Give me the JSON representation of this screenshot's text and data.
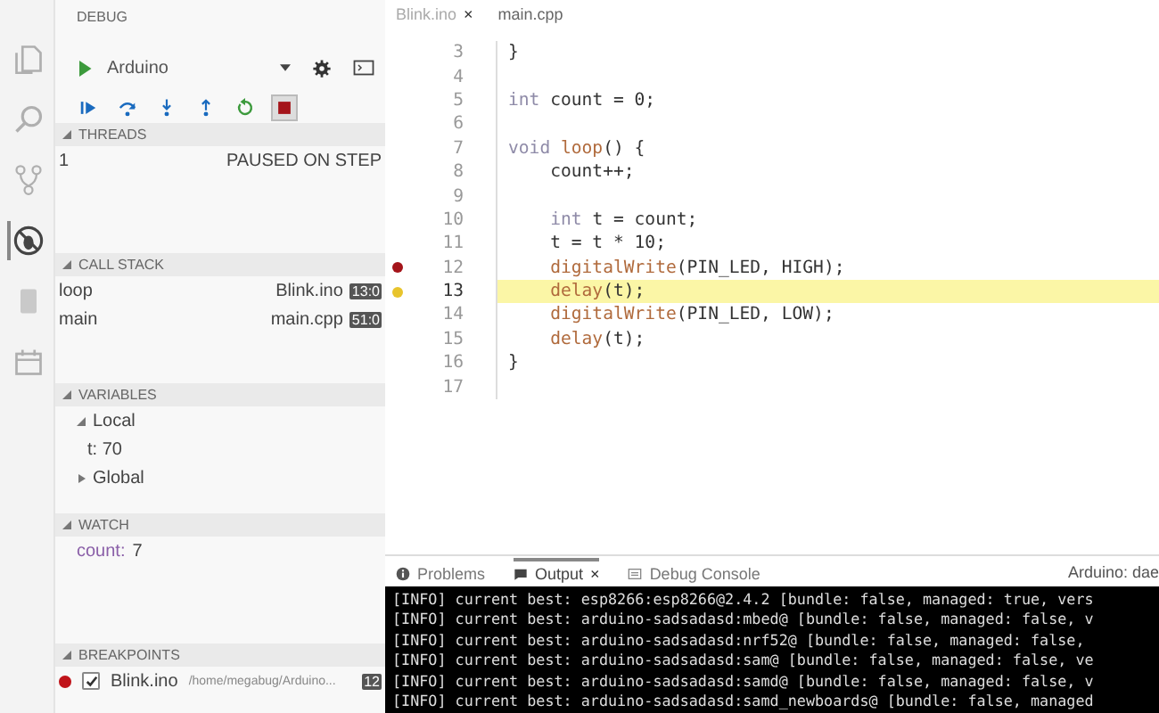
{
  "activity_bar": [
    {
      "kind": "files",
      "selected": false
    },
    {
      "kind": "search",
      "selected": false
    },
    {
      "kind": "source-control",
      "selected": false
    },
    {
      "kind": "debug",
      "selected": true
    },
    {
      "kind": "board",
      "selected": false
    },
    {
      "kind": "calendar",
      "selected": false
    }
  ],
  "sidebar": {
    "title": "DEBUG",
    "configuration": "Arduino",
    "toolbar": [
      {
        "kind": "continue",
        "hovered": false
      },
      {
        "kind": "step-over",
        "hovered": false
      },
      {
        "kind": "step-into",
        "hovered": false
      },
      {
        "kind": "step-out",
        "hovered": false
      },
      {
        "kind": "restart",
        "hovered": false
      },
      {
        "kind": "stop",
        "hovered": true
      }
    ],
    "sections": [
      {
        "kind": "threads",
        "title": "THREADS",
        "expanded": true,
        "rows": [
          {
            "id": "1",
            "status": "PAUSED ON STEP"
          }
        ]
      },
      {
        "kind": "call_stack",
        "title": "CALL STACK",
        "expanded": true,
        "frames": [
          {
            "name": "loop",
            "file": "Blink.ino",
            "position": "13:0"
          },
          {
            "name": "main",
            "file": "main.cpp",
            "position": "51:0"
          }
        ]
      },
      {
        "kind": "variables",
        "title": "VARIABLES",
        "expanded": true,
        "scopes": [
          {
            "name": "Local",
            "expanded": true,
            "children": [
              {
                "text": "t: 70"
              }
            ]
          },
          {
            "name": "Global",
            "expanded": false
          }
        ]
      },
      {
        "kind": "watch",
        "title": "WATCH",
        "expanded": true,
        "items": [
          {
            "name": "count:",
            "value": "7"
          }
        ]
      },
      {
        "kind": "breakpoints",
        "title": "BREAKPOINTS",
        "expanded": true,
        "items": [
          {
            "file": "Blink.ino",
            "path": "/home/megabug/Arduino...",
            "line": "12",
            "checked": true
          }
        ]
      }
    ]
  },
  "editor": {
    "tabs": [
      {
        "label": "Blink.ino",
        "close": "×",
        "selected": true
      },
      {
        "label": "main.cpp",
        "selected": false
      }
    ],
    "lines": [
      {
        "number": "3",
        "breakpoint": false,
        "current": false,
        "tokens": [
          {
            "text": "}",
            "kind": "plain"
          }
        ]
      },
      {
        "number": "4",
        "breakpoint": false,
        "current": false
      },
      {
        "number": "5",
        "breakpoint": false,
        "current": false,
        "tokens": [
          {
            "text": "int",
            "kind": "keyword"
          },
          {
            "text": " count = 0;",
            "kind": "plain"
          }
        ]
      },
      {
        "number": "6",
        "breakpoint": false,
        "current": false
      },
      {
        "number": "7",
        "breakpoint": false,
        "current": false,
        "tokens": [
          {
            "text": "void",
            "kind": "keyword"
          },
          {
            "text": " loop",
            "kind": "function"
          },
          {
            "text": "() {",
            "kind": "plain"
          }
        ]
      },
      {
        "number": "8",
        "breakpoint": false,
        "current": false,
        "tokens": [
          {
            "text": "    count++;",
            "kind": "plain"
          }
        ]
      },
      {
        "number": "9",
        "breakpoint": false,
        "current": false
      },
      {
        "number": "10",
        "breakpoint": false,
        "current": false,
        "tokens": [
          {
            "text": "    int",
            "kind": "keyword"
          },
          {
            "text": " t = count;",
            "kind": "plain"
          }
        ]
      },
      {
        "number": "11",
        "breakpoint": false,
        "current": false,
        "tokens": [
          {
            "text": "    t = t * 10;",
            "kind": "plain"
          }
        ]
      },
      {
        "number": "12",
        "breakpoint": true,
        "current": false,
        "tokens": [
          {
            "text": "    digitalWrite",
            "kind": "function"
          },
          {
            "text": "(PIN_LED, HIGH);",
            "kind": "plain"
          }
        ]
      },
      {
        "number": "13",
        "breakpoint": false,
        "current": true,
        "tokens": [
          {
            "text": "    delay",
            "kind": "function"
          },
          {
            "text": "(t);",
            "kind": "plain"
          }
        ]
      },
      {
        "number": "14",
        "breakpoint": false,
        "current": false,
        "tokens": [
          {
            "text": "    digitalWrite",
            "kind": "function"
          },
          {
            "text": "(PIN_LED, LOW);",
            "kind": "plain"
          }
        ]
      },
      {
        "number": "15",
        "breakpoint": false,
        "current": false,
        "tokens": [
          {
            "text": "    delay",
            "kind": "function"
          },
          {
            "text": "(t);",
            "kind": "plain"
          }
        ]
      },
      {
        "number": "16",
        "breakpoint": false,
        "current": false,
        "tokens": [
          {
            "text": "}",
            "kind": "plain"
          }
        ]
      },
      {
        "number": "17",
        "breakpoint": false,
        "current": false
      }
    ]
  },
  "panel": {
    "tabs": [
      {
        "label": "Problems",
        "kind": "problems",
        "selected": false
      },
      {
        "label": "Output",
        "kind": "output",
        "close": "×",
        "selected": true
      },
      {
        "label": "Debug Console",
        "kind": "console",
        "selected": false
      }
    ],
    "channel": "Arduino: dae",
    "output": [
      "[INFO] current best: esp8266:esp8266@2.4.2 [bundle: false, managed: true, vers",
      "[INFO] current best: arduino-sadsadasd:mbed@ [bundle: false, managed: false, v",
      "[INFO] current best: arduino-sadsadasd:nrf52@ [bundle: false, managed: false,",
      "[INFO] current best: arduino-sadsadasd:sam@ [bundle: false, managed: false, ve",
      "[INFO] current best: arduino-sadsadasd:samd@ [bundle: false, managed: false, v",
      "[INFO] current best: arduino-sadsadasd:samd_newboards@ [bundle: false, managed"
    ]
  }
}
